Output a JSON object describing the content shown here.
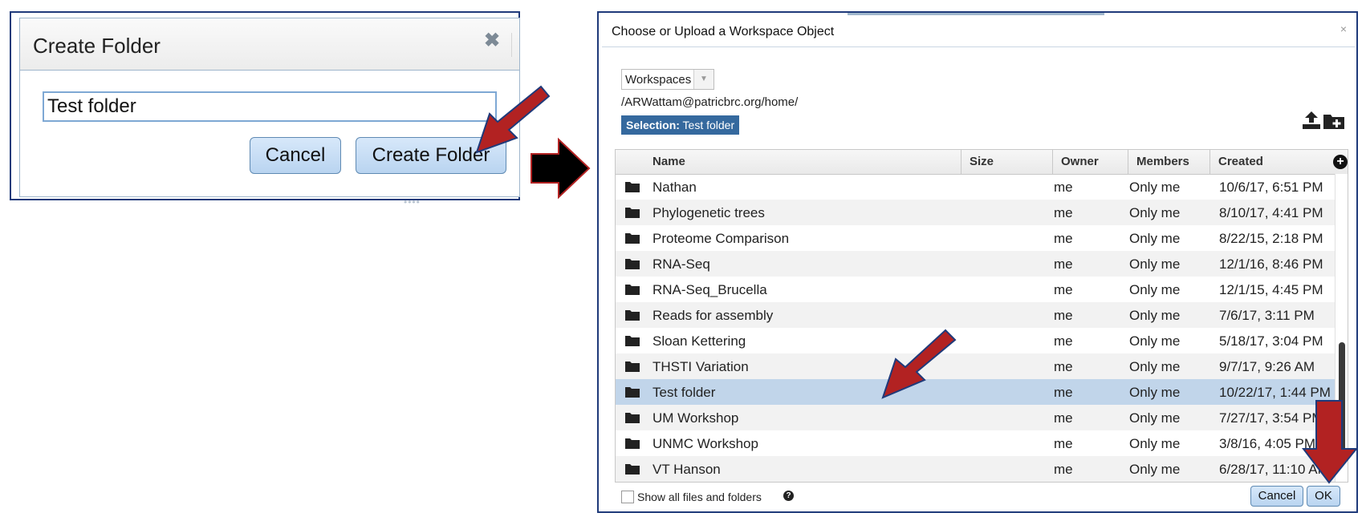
{
  "create_folder_dialog": {
    "title": "Create Folder",
    "close_glyph": "✖",
    "input_value": "Test folder",
    "cancel_label": "Cancel",
    "create_label": "Create Folder",
    "grip_glyph": "••••"
  },
  "workspace_dialog": {
    "title": "Choose or Upload a Workspace Object",
    "close_glyph": "×",
    "location_select": "Workspaces",
    "path": "/ARWattam@patricbrc.org/home/",
    "selection_label": "Selection:",
    "selection_value": "Test folder",
    "columns": {
      "name": "Name",
      "size": "Size",
      "owner": "Owner",
      "members": "Members",
      "created": "Created"
    },
    "rows": [
      {
        "name": "Nathan",
        "owner": "me",
        "members": "Only me",
        "created": "10/6/17, 6:51 PM"
      },
      {
        "name": "Phylogenetic trees",
        "owner": "me",
        "members": "Only me",
        "created": "8/10/17, 4:41 PM"
      },
      {
        "name": "Proteome Comparison",
        "owner": "me",
        "members": "Only me",
        "created": "8/22/15, 2:18 PM"
      },
      {
        "name": "RNA-Seq",
        "owner": "me",
        "members": "Only me",
        "created": "12/1/16, 8:46 PM"
      },
      {
        "name": "RNA-Seq_Brucella",
        "owner": "me",
        "members": "Only me",
        "created": "12/1/15, 4:45 PM"
      },
      {
        "name": "Reads for assembly",
        "owner": "me",
        "members": "Only me",
        "created": "7/6/17, 3:11 PM"
      },
      {
        "name": "Sloan Kettering",
        "owner": "me",
        "members": "Only me",
        "created": "5/18/17, 3:04 PM"
      },
      {
        "name": "THSTI Variation",
        "owner": "me",
        "members": "Only me",
        "created": "9/7/17, 9:26 AM"
      },
      {
        "name": "Test folder",
        "owner": "me",
        "members": "Only me",
        "created": "10/22/17, 1:44 PM"
      },
      {
        "name": "UM Workshop",
        "owner": "me",
        "members": "Only me",
        "created": "7/27/17, 3:54 PM"
      },
      {
        "name": "UNMC Workshop",
        "owner": "me",
        "members": "Only me",
        "created": "3/8/16, 4:05 PM"
      },
      {
        "name": "VT Hanson",
        "owner": "me",
        "members": "Only me",
        "created": "6/28/17, 11:10 AM"
      }
    ],
    "selected_row_name": "Test folder",
    "show_all_label": "Show all files and folders",
    "show_all_checked": false,
    "cancel_label": "Cancel",
    "ok_label": "OK"
  },
  "colors": {
    "annotation_arrow": "#b22222",
    "selection_badge": "#35699e",
    "selected_row": "#c1d5ea",
    "button": "#c9def4"
  }
}
